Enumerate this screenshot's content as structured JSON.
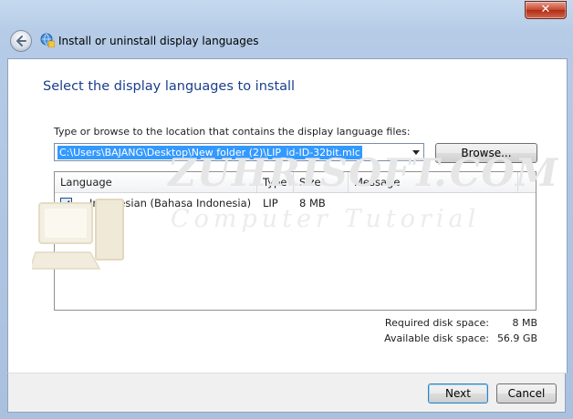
{
  "window": {
    "title": "Install or uninstall display languages",
    "close_glyph": "✕"
  },
  "heading": "Select the display languages to install",
  "location": {
    "label": "Type or browse to the location that contains the display language files:",
    "path_value": "C:\\Users\\BAJANG\\Desktop\\New folder (2)\\LIP_id-ID-32bit.mlc",
    "browse_label": "Browse..."
  },
  "table": {
    "columns": [
      "Language",
      "Type",
      "Size",
      "Message"
    ],
    "rows": [
      {
        "checked": true,
        "language": "Indonesian (Bahasa Indonesia)",
        "type": "LIP",
        "size": "8 MB",
        "message": ""
      }
    ]
  },
  "watermark": {
    "main": "ZUHRISOFT.COM",
    "sub": "Computer Tutorial"
  },
  "disk": {
    "required_label": "Required disk space:",
    "required_value": "8 MB",
    "available_label": "Available disk space:",
    "available_value": "56.9 GB"
  },
  "footer": {
    "next_label": "Next",
    "cancel_label": "Cancel"
  },
  "colors": {
    "heading": "#1a3e8c",
    "selection": "#3399ff",
    "frame": "#b5cbe6",
    "close": "#c5442c"
  },
  "icons": {
    "back": "back-arrow-icon",
    "title": "language-globe-icon",
    "close": "close-icon",
    "dropdown": "chevron-down-icon",
    "check": "checkmark-icon"
  }
}
